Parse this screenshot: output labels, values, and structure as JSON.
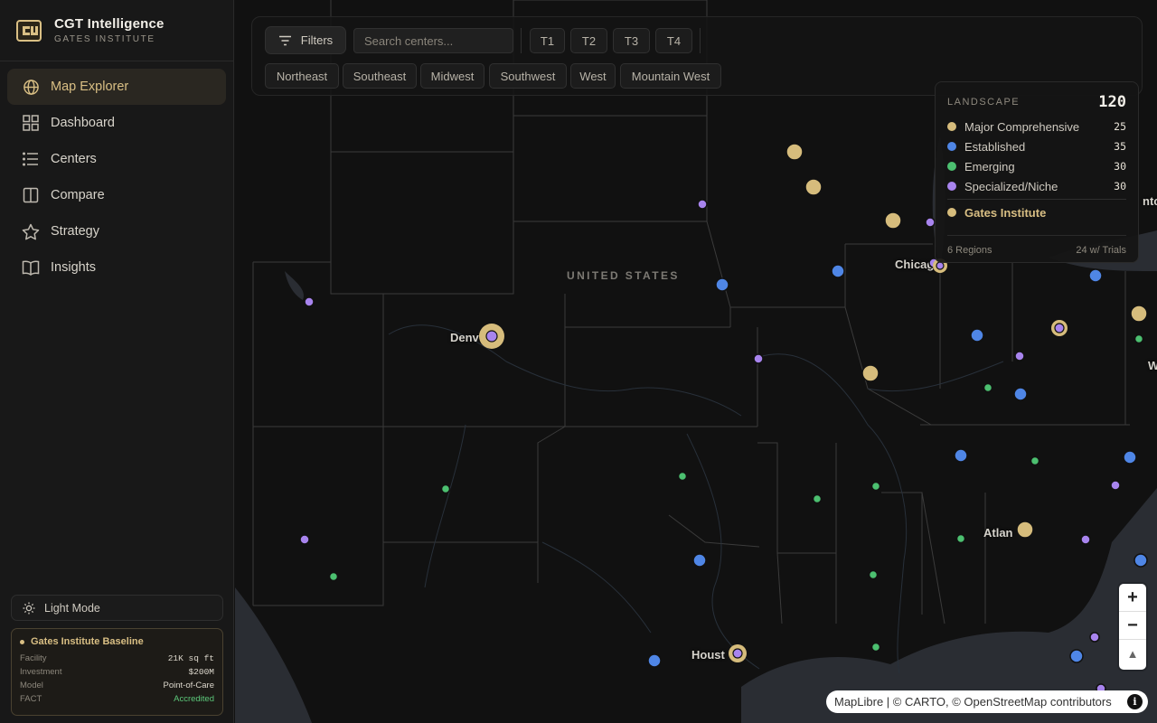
{
  "brand": {
    "title": "CGT Intelligence",
    "subtitle": "GATES INSTITUTE"
  },
  "nav": {
    "items": [
      {
        "label": "Map Explorer",
        "icon": "globe-icon",
        "active": true
      },
      {
        "label": "Dashboard",
        "icon": "grid-icon"
      },
      {
        "label": "Centers",
        "icon": "list-icon"
      },
      {
        "label": "Compare",
        "icon": "columns-icon"
      },
      {
        "label": "Strategy",
        "icon": "star-icon"
      },
      {
        "label": "Insights",
        "icon": "book-icon"
      }
    ]
  },
  "theme_toggle": {
    "label": "Light Mode"
  },
  "baseline": {
    "title": "Gates Institute Baseline",
    "rows": [
      {
        "label": "Facility",
        "value": "21K sq ft"
      },
      {
        "label": "Investment",
        "value": "$200M"
      },
      {
        "label": "Model",
        "value": "Point-of-Care"
      },
      {
        "label": "FACT",
        "value": "Accredited"
      }
    ]
  },
  "toolbar": {
    "filters_label": "Filters",
    "search_placeholder": "Search centers...",
    "tiers": [
      "T1",
      "T2",
      "T3",
      "T4"
    ],
    "regions": [
      "Northeast",
      "Southeast",
      "Midwest",
      "Southwest",
      "West",
      "Mountain West"
    ]
  },
  "legend": {
    "title": "LANDSCAPE",
    "total": "120",
    "items": [
      {
        "label": "Major Comprehensive",
        "count": "25",
        "color": "#d6bc7c"
      },
      {
        "label": "Established",
        "count": "35",
        "color": "#4f86e6"
      },
      {
        "label": "Emerging",
        "count": "30",
        "color": "#4cc070"
      },
      {
        "label": "Specialized/Niche",
        "count": "30",
        "color": "#a884ee"
      }
    ],
    "gates_label": "Gates Institute",
    "footer_left": "6 Regions",
    "footer_right": "24 w/ Trials"
  },
  "map": {
    "country_label": "UNITED STATES",
    "city_labels": [
      "Denv",
      "Chicag",
      "Atlan",
      "Houst"
    ],
    "partial_labels": [
      "nto",
      "W"
    ]
  },
  "zoom": {
    "in": "+",
    "out": "−",
    "compass": "▲"
  },
  "attribution": {
    "text": "MapLibre | © CARTO, © OpenStreetMap contributors",
    "info": "i"
  },
  "colors": {
    "accent": "#d9bf84",
    "established": "#4f86e6",
    "emerging": "#4cc070",
    "niche": "#a884ee",
    "major": "#d6bc7c"
  }
}
